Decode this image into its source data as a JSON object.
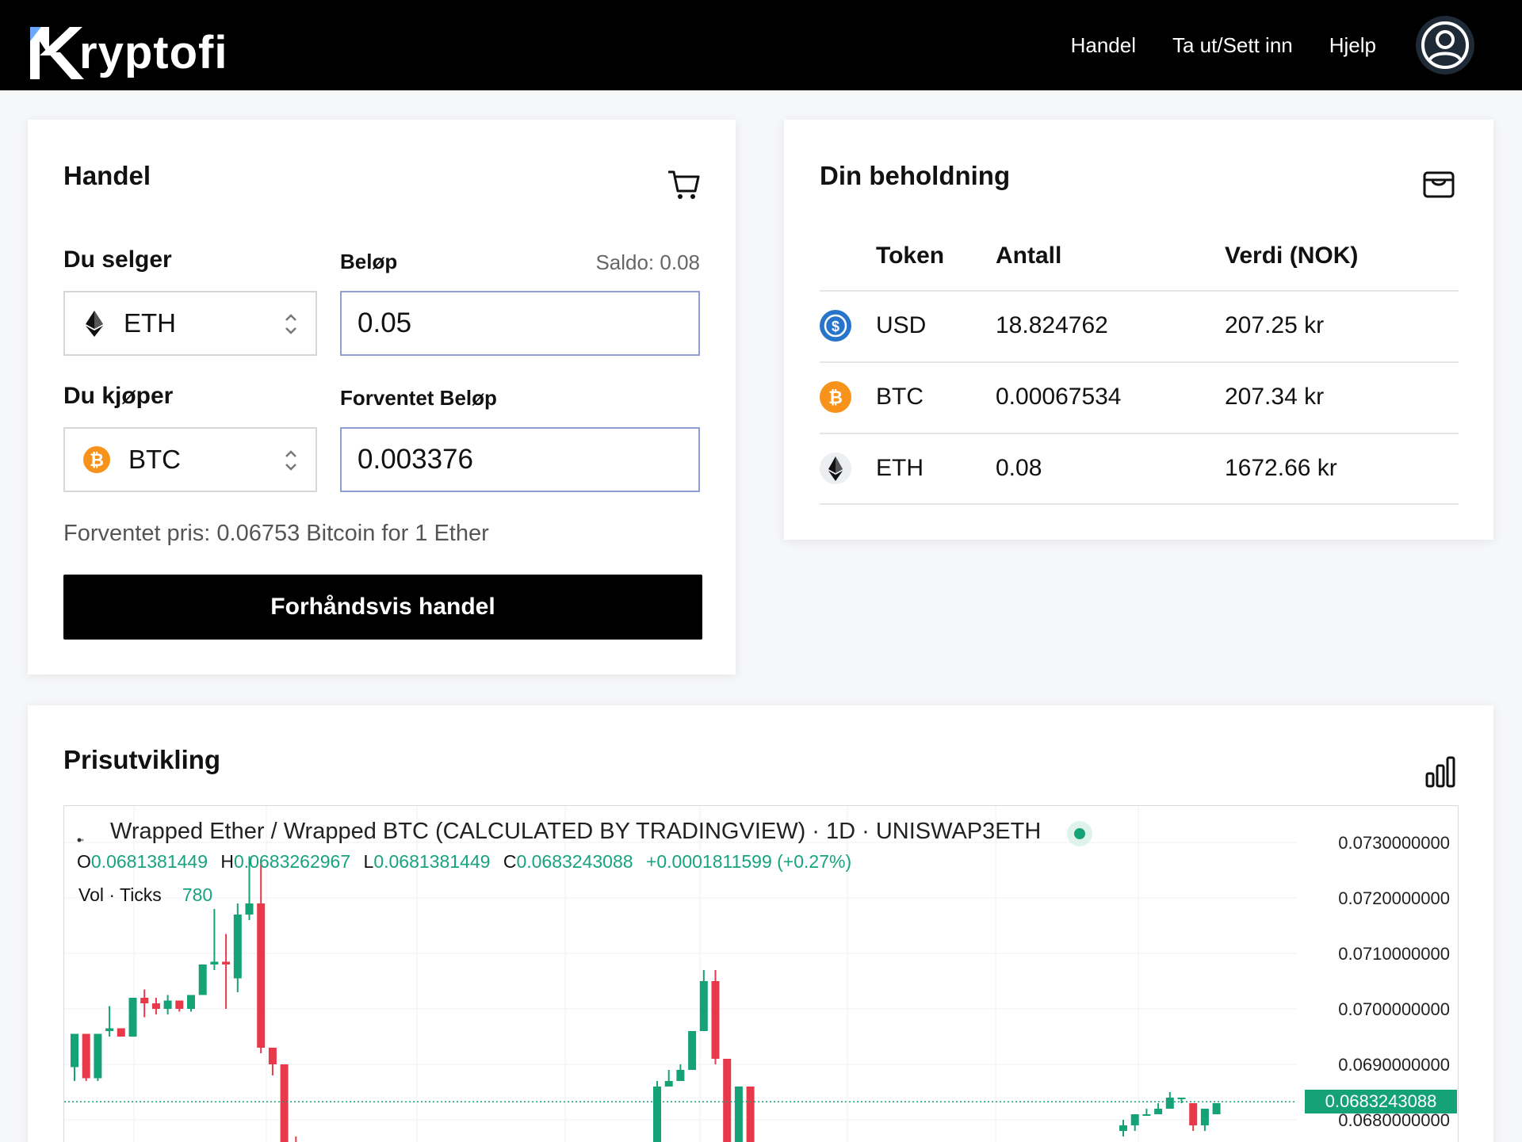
{
  "brand": {
    "name": "ryptofi",
    "mark": "K"
  },
  "nav": {
    "items": [
      {
        "label": "Handel"
      },
      {
        "label": "Ta ut/Sett inn"
      },
      {
        "label": "Hjelp"
      }
    ]
  },
  "trade": {
    "title": "Handel",
    "sell_label": "Du selger",
    "amount_label": "Beløp",
    "balance": "Saldo: 0.08",
    "sell_token": "ETH",
    "sell_amount": "0.05",
    "buy_label": "Du kjøper",
    "expected_amount_label": "Forventet Beløp",
    "buy_token": "BTC",
    "buy_amount": "0.003376",
    "expected_price": "Forventet pris: 0.06753 Bitcoin for 1 Ether",
    "preview_button": "Forhåndsvis handel"
  },
  "holdings": {
    "title": "Din beholdning",
    "columns": [
      "Token",
      "Antall",
      "Verdi (NOK)"
    ],
    "rows": [
      {
        "token": "USD",
        "amount": "18.824762",
        "value": "207.25 kr",
        "icon": "usd-coin-icon"
      },
      {
        "token": "BTC",
        "amount": "0.00067534",
        "value": "207.34 kr",
        "icon": "bitcoin-icon"
      },
      {
        "token": "ETH",
        "amount": "0.08",
        "value": "1672.66 kr",
        "icon": "ethereum-icon"
      }
    ]
  },
  "chart": {
    "title": "Prisutvikling",
    "symbol_line": "Wrapped Ether / Wrapped BTC (CALCULATED BY TRADINGVIEW) · 1D · UNISWAP3ETH",
    "ohlc": {
      "o_label": "O",
      "o": "0.0681381449",
      "h_label": "H",
      "h": "0.0683262967",
      "l_label": "L",
      "l": "0.0681381449",
      "c_label": "C",
      "c": "0.0683243088",
      "change": "+0.0001811599 (+0.27%)"
    },
    "volume_label": "Vol · Ticks",
    "volume_value": "780",
    "current_price": "0.0683243088",
    "colors": {
      "up": "#16a277",
      "down": "#e8394a"
    }
  },
  "chart_data": {
    "type": "candlestick",
    "title": "Wrapped Ether / Wrapped BTC (CALCULATED BY TRADINGVIEW) · 1D · UNISWAP3ETH",
    "y_ticks": [
      "0.0730000000",
      "0.0720000000",
      "0.0710000000",
      "0.0700000000",
      "0.0690000000",
      "0.0680000000"
    ],
    "ylim": [
      0.0673,
      0.0737
    ],
    "current": 0.0683243088,
    "candles": [
      {
        "i": 0,
        "o": 0.06895,
        "c": 0.06955,
        "h": 0.06955,
        "l": 0.0687
      },
      {
        "i": 1,
        "o": 0.06955,
        "c": 0.06875,
        "h": 0.06955,
        "l": 0.0687
      },
      {
        "i": 2,
        "o": 0.06875,
        "c": 0.06955,
        "h": 0.06955,
        "l": 0.0687
      },
      {
        "i": 3,
        "o": 0.0696,
        "c": 0.06965,
        "h": 0.07005,
        "l": 0.0695
      },
      {
        "i": 4,
        "o": 0.06965,
        "c": 0.0695,
        "h": 0.06965,
        "l": 0.0695
      },
      {
        "i": 5,
        "o": 0.0695,
        "c": 0.0702,
        "h": 0.0702,
        "l": 0.0695
      },
      {
        "i": 6,
        "o": 0.0702,
        "c": 0.0701,
        "h": 0.07035,
        "l": 0.06985
      },
      {
        "i": 7,
        "o": 0.0701,
        "c": 0.07,
        "h": 0.0702,
        "l": 0.0699
      },
      {
        "i": 8,
        "o": 0.07,
        "c": 0.07015,
        "h": 0.07025,
        "l": 0.0699
      },
      {
        "i": 9,
        "o": 0.07015,
        "c": 0.07,
        "h": 0.07015,
        "l": 0.06995
      },
      {
        "i": 10,
        "o": 0.07,
        "c": 0.07025,
        "h": 0.07025,
        "l": 0.06995
      },
      {
        "i": 11,
        "o": 0.07025,
        "c": 0.0708,
        "h": 0.0708,
        "l": 0.07025
      },
      {
        "i": 12,
        "o": 0.0708,
        "c": 0.07085,
        "h": 0.0718,
        "l": 0.0707
      },
      {
        "i": 13,
        "o": 0.07085,
        "c": 0.0708,
        "h": 0.07135,
        "l": 0.07
      },
      {
        "i": 14,
        "o": 0.07055,
        "c": 0.0717,
        "h": 0.0719,
        "l": 0.0703
      },
      {
        "i": 15,
        "o": 0.0717,
        "c": 0.0719,
        "h": 0.07275,
        "l": 0.0716
      },
      {
        "i": 16,
        "o": 0.0719,
        "c": 0.0693,
        "h": 0.0727,
        "l": 0.0692
      },
      {
        "i": 17,
        "o": 0.0693,
        "c": 0.069,
        "h": 0.0693,
        "l": 0.0688
      },
      {
        "i": 18,
        "o": 0.069,
        "c": 0.0675,
        "h": 0.069,
        "l": 0.0674
      },
      {
        "i": 19,
        "o": 0.0676,
        "c": 0.0674,
        "h": 0.0677,
        "l": 0.0673
      },
      {
        "i": 50,
        "o": 0.0675,
        "c": 0.0686,
        "h": 0.0687,
        "l": 0.0674
      },
      {
        "i": 51,
        "o": 0.0686,
        "c": 0.0687,
        "h": 0.0689,
        "l": 0.0686
      },
      {
        "i": 52,
        "o": 0.0687,
        "c": 0.0689,
        "h": 0.069,
        "l": 0.0687
      },
      {
        "i": 53,
        "o": 0.0689,
        "c": 0.0696,
        "h": 0.0696,
        "l": 0.0689
      },
      {
        "i": 54,
        "o": 0.0696,
        "c": 0.0705,
        "h": 0.0707,
        "l": 0.0696
      },
      {
        "i": 55,
        "o": 0.0705,
        "c": 0.0691,
        "h": 0.0707,
        "l": 0.069
      },
      {
        "i": 56,
        "o": 0.0691,
        "c": 0.0675,
        "h": 0.0691,
        "l": 0.0674
      },
      {
        "i": 57,
        "o": 0.0674,
        "c": 0.0686,
        "h": 0.0686,
        "l": 0.0673
      },
      {
        "i": 58,
        "o": 0.0686,
        "c": 0.0675,
        "h": 0.0686,
        "l": 0.0674
      },
      {
        "i": 59,
        "o": 0.0676,
        "c": 0.0675,
        "h": 0.0676,
        "l": 0.0674
      },
      {
        "i": 90,
        "o": 0.0678,
        "c": 0.0679,
        "h": 0.068,
        "l": 0.0677
      },
      {
        "i": 91,
        "o": 0.0679,
        "c": 0.0681,
        "h": 0.0681,
        "l": 0.0678
      },
      {
        "i": 92,
        "o": 0.0681,
        "c": 0.0681,
        "h": 0.0682,
        "l": 0.0681
      },
      {
        "i": 93,
        "o": 0.0681,
        "c": 0.0682,
        "h": 0.0683,
        "l": 0.0681
      },
      {
        "i": 94,
        "o": 0.0682,
        "c": 0.0684,
        "h": 0.0685,
        "l": 0.0682
      },
      {
        "i": 95,
        "o": 0.0684,
        "c": 0.0684,
        "h": 0.0684,
        "l": 0.0683
      },
      {
        "i": 96,
        "o": 0.0683,
        "c": 0.0679,
        "h": 0.0683,
        "l": 0.0678
      },
      {
        "i": 97,
        "o": 0.0679,
        "c": 0.0682,
        "h": 0.0682,
        "l": 0.0678
      },
      {
        "i": 98,
        "o": 0.0681,
        "c": 0.0683,
        "h": 0.0683,
        "l": 0.0681
      }
    ]
  }
}
